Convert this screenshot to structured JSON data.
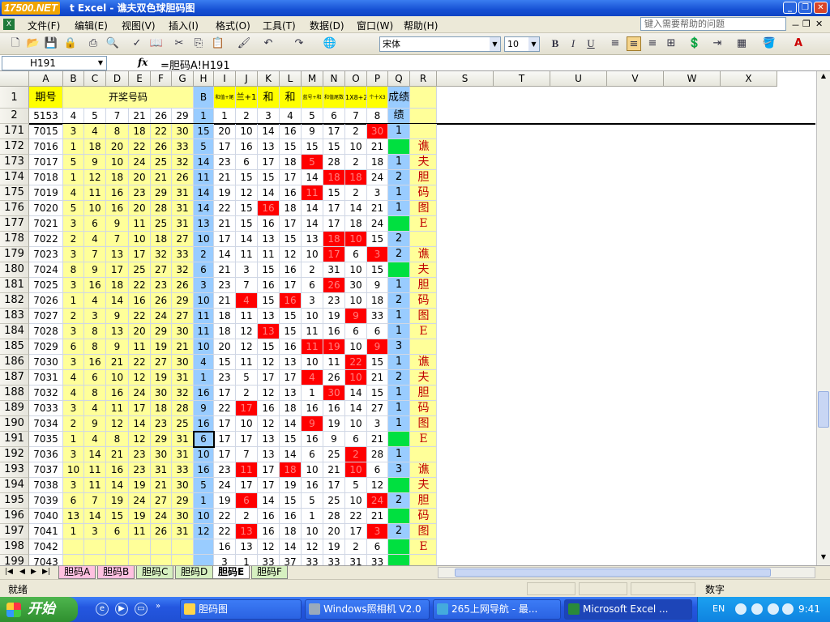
{
  "title": {
    "logo": "17500.NET",
    "text": "t Excel - 谯夫双色球胆码图"
  },
  "menu": [
    "文件(F)",
    "编辑(E)",
    "视图(V)",
    "插入(I)",
    "格式(O)",
    "工具(T)",
    "数据(D)",
    "窗口(W)",
    "帮助(H)"
  ],
  "help_placeholder": "键入需要帮助的问题",
  "font": {
    "name": "宋体",
    "size": "10"
  },
  "namebox": "H191",
  "fx": "fx",
  "formula": "=胆码A!H191",
  "columns": [
    "A",
    "B",
    "C",
    "D",
    "E",
    "F",
    "G",
    "H",
    "I",
    "J",
    "K",
    "L",
    "M",
    "N",
    "O",
    "P",
    "Q",
    "R",
    "S",
    "T",
    "U",
    "V",
    "W",
    "X"
  ],
  "header_row1": {
    "rownum": "1",
    "A": "期号",
    "BG": "开奖号码",
    "H": "B",
    "I": "和值+尾",
    "J": "兰+1",
    "K": "和",
    "L": "和",
    "M": "蓝号+和",
    "N": "和值尾数",
    "O": "1X8+2",
    "P": "个十X3",
    "Q": "成绩"
  },
  "header_row2": {
    "rownum": "2",
    "A": "5153",
    "nums": [
      "4",
      "5",
      "7",
      "21",
      "26",
      "29"
    ],
    "H": "1",
    "idx": [
      "1",
      "2",
      "3",
      "4",
      "5",
      "6",
      "7",
      "8"
    ],
    "Q": "绩"
  },
  "rows": [
    {
      "r": "171",
      "id": "7015",
      "n": [
        "3",
        "4",
        "8",
        "18",
        "22",
        "30"
      ],
      "b": "15",
      "d": [
        "20",
        "10",
        "14",
        "16",
        "9",
        "17",
        "2",
        "30"
      ],
      "red": [
        7
      ],
      "q": "1"
    },
    {
      "r": "172",
      "id": "7016",
      "n": [
        "1",
        "18",
        "20",
        "22",
        "26",
        "33"
      ],
      "b": "5",
      "d": [
        "17",
        "16",
        "13",
        "15",
        "15",
        "15",
        "10",
        "21"
      ],
      "red": [],
      "q": ""
    },
    {
      "r": "173",
      "id": "7017",
      "n": [
        "5",
        "9",
        "10",
        "24",
        "25",
        "32"
      ],
      "b": "14",
      "d": [
        "23",
        "6",
        "17",
        "18",
        "5",
        "28",
        "2",
        "18"
      ],
      "red": [
        4
      ],
      "q": "1"
    },
    {
      "r": "174",
      "id": "7018",
      "n": [
        "1",
        "12",
        "18",
        "20",
        "21",
        "26"
      ],
      "b": "11",
      "d": [
        "21",
        "15",
        "15",
        "17",
        "14",
        "18",
        "18",
        "24"
      ],
      "red": [
        5,
        6
      ],
      "q": "2"
    },
    {
      "r": "175",
      "id": "7019",
      "n": [
        "4",
        "11",
        "16",
        "23",
        "29",
        "31"
      ],
      "b": "14",
      "d": [
        "19",
        "12",
        "14",
        "16",
        "11",
        "15",
        "2",
        "3"
      ],
      "red": [
        4
      ],
      "q": "1"
    },
    {
      "r": "176",
      "id": "7020",
      "n": [
        "5",
        "10",
        "16",
        "20",
        "28",
        "31"
      ],
      "b": "14",
      "d": [
        "22",
        "15",
        "16",
        "18",
        "14",
        "17",
        "14",
        "21"
      ],
      "red": [
        2
      ],
      "q": "1"
    },
    {
      "r": "177",
      "id": "7021",
      "n": [
        "3",
        "6",
        "9",
        "11",
        "25",
        "31"
      ],
      "b": "13",
      "d": [
        "21",
        "15",
        "16",
        "17",
        "14",
        "17",
        "18",
        "24"
      ],
      "red": [],
      "q": ""
    },
    {
      "r": "178",
      "id": "7022",
      "n": [
        "2",
        "4",
        "7",
        "10",
        "18",
        "27"
      ],
      "b": "10",
      "d": [
        "17",
        "14",
        "13",
        "15",
        "13",
        "18",
        "10",
        "15"
      ],
      "red": [
        5,
        6
      ],
      "q": "2"
    },
    {
      "r": "179",
      "id": "7023",
      "n": [
        "3",
        "7",
        "13",
        "17",
        "32",
        "33"
      ],
      "b": "2",
      "d": [
        "14",
        "11",
        "11",
        "12",
        "10",
        "17",
        "6",
        "3"
      ],
      "red": [
        5,
        7
      ],
      "q": "2"
    },
    {
      "r": "180",
      "id": "7024",
      "n": [
        "8",
        "9",
        "17",
        "25",
        "27",
        "32"
      ],
      "b": "6",
      "d": [
        "21",
        "3",
        "15",
        "16",
        "2",
        "31",
        "10",
        "15"
      ],
      "red": [],
      "q": ""
    },
    {
      "r": "181",
      "id": "7025",
      "n": [
        "3",
        "16",
        "18",
        "22",
        "23",
        "26"
      ],
      "b": "3",
      "d": [
        "23",
        "7",
        "16",
        "17",
        "6",
        "26",
        "30",
        "9"
      ],
      "red": [
        5
      ],
      "q": "1"
    },
    {
      "r": "182",
      "id": "7026",
      "n": [
        "1",
        "4",
        "14",
        "16",
        "26",
        "29"
      ],
      "b": "10",
      "d": [
        "21",
        "4",
        "15",
        "16",
        "3",
        "23",
        "10",
        "18"
      ],
      "red": [
        1,
        3
      ],
      "q": "2"
    },
    {
      "r": "183",
      "id": "7027",
      "n": [
        "2",
        "3",
        "9",
        "22",
        "24",
        "27"
      ],
      "b": "11",
      "d": [
        "18",
        "11",
        "13",
        "15",
        "10",
        "19",
        "9",
        "33"
      ],
      "red": [
        6
      ],
      "q": "1"
    },
    {
      "r": "184",
      "id": "7028",
      "n": [
        "3",
        "8",
        "13",
        "20",
        "29",
        "30"
      ],
      "b": "11",
      "d": [
        "18",
        "12",
        "13",
        "15",
        "11",
        "16",
        "6",
        "6"
      ],
      "red": [
        2
      ],
      "q": "1"
    },
    {
      "r": "185",
      "id": "7029",
      "n": [
        "6",
        "8",
        "9",
        "11",
        "19",
        "21"
      ],
      "b": "10",
      "d": [
        "20",
        "12",
        "15",
        "16",
        "11",
        "19",
        "10",
        "9"
      ],
      "red": [
        4,
        5,
        7
      ],
      "q": "3"
    },
    {
      "r": "186",
      "id": "7030",
      "n": [
        "3",
        "16",
        "21",
        "22",
        "27",
        "30"
      ],
      "b": "4",
      "d": [
        "15",
        "11",
        "12",
        "13",
        "10",
        "11",
        "22",
        "15"
      ],
      "red": [
        6
      ],
      "q": "1"
    },
    {
      "r": "187",
      "id": "7031",
      "n": [
        "4",
        "6",
        "10",
        "12",
        "19",
        "31"
      ],
      "b": "1",
      "d": [
        "23",
        "5",
        "17",
        "17",
        "4",
        "26",
        "10",
        "21"
      ],
      "red": [
        4,
        6
      ],
      "q": "2"
    },
    {
      "r": "188",
      "id": "7032",
      "n": [
        "4",
        "8",
        "16",
        "24",
        "30",
        "32"
      ],
      "b": "16",
      "d": [
        "17",
        "2",
        "12",
        "13",
        "1",
        "30",
        "14",
        "15"
      ],
      "red": [
        5
      ],
      "q": "1"
    },
    {
      "r": "189",
      "id": "7033",
      "n": [
        "3",
        "4",
        "11",
        "17",
        "18",
        "28"
      ],
      "b": "9",
      "d": [
        "22",
        "17",
        "16",
        "18",
        "16",
        "16",
        "14",
        "27"
      ],
      "red": [
        1
      ],
      "q": "1"
    },
    {
      "r": "190",
      "id": "7034",
      "n": [
        "2",
        "9",
        "12",
        "14",
        "23",
        "25"
      ],
      "b": "16",
      "d": [
        "17",
        "10",
        "12",
        "14",
        "9",
        "19",
        "10",
        "3"
      ],
      "red": [
        4
      ],
      "q": "1"
    },
    {
      "r": "191",
      "id": "7035",
      "n": [
        "1",
        "4",
        "8",
        "12",
        "29",
        "31"
      ],
      "b": "6",
      "d": [
        "17",
        "17",
        "13",
        "15",
        "16",
        "9",
        "6",
        "21"
      ],
      "red": [],
      "q": ""
    },
    {
      "r": "192",
      "id": "7036",
      "n": [
        "3",
        "14",
        "21",
        "23",
        "30",
        "31"
      ],
      "b": "10",
      "d": [
        "17",
        "7",
        "13",
        "14",
        "6",
        "25",
        "2",
        "28"
      ],
      "red": [
        6
      ],
      "q": "1"
    },
    {
      "r": "193",
      "id": "7037",
      "n": [
        "10",
        "11",
        "16",
        "23",
        "31",
        "33"
      ],
      "b": "16",
      "d": [
        "23",
        "11",
        "17",
        "18",
        "10",
        "21",
        "10",
        "6"
      ],
      "red": [
        1,
        3,
        6
      ],
      "q": "3"
    },
    {
      "r": "194",
      "id": "7038",
      "n": [
        "3",
        "11",
        "14",
        "19",
        "21",
        "30"
      ],
      "b": "5",
      "d": [
        "24",
        "17",
        "17",
        "19",
        "16",
        "17",
        "5",
        "12"
      ],
      "red": [],
      "q": ""
    },
    {
      "r": "195",
      "id": "7039",
      "n": [
        "6",
        "7",
        "19",
        "24",
        "27",
        "29"
      ],
      "b": "1",
      "d": [
        "19",
        "6",
        "14",
        "15",
        "5",
        "25",
        "10",
        "24"
      ],
      "red": [
        1,
        7
      ],
      "q": "2"
    },
    {
      "r": "196",
      "id": "7040",
      "n": [
        "13",
        "14",
        "15",
        "19",
        "24",
        "30"
      ],
      "b": "10",
      "d": [
        "22",
        "2",
        "16",
        "16",
        "1",
        "28",
        "22",
        "21"
      ],
      "red": [],
      "q": ""
    },
    {
      "r": "197",
      "id": "7041",
      "n": [
        "1",
        "3",
        "6",
        "11",
        "26",
        "31"
      ],
      "b": "12",
      "d": [
        "22",
        "13",
        "16",
        "18",
        "10",
        "20",
        "17",
        "3"
      ],
      "red": [
        1,
        7
      ],
      "q": "2"
    },
    {
      "r": "198",
      "id": "7042",
      "n": [
        "",
        "",
        "",
        "",
        "",
        ""
      ],
      "b": "",
      "d": [
        "16",
        "13",
        "12",
        "14",
        "12",
        "19",
        "2",
        "6"
      ],
      "red": [],
      "q": ""
    },
    {
      "r": "199",
      "id": "7043",
      "n": [
        "",
        "",
        "",
        "",
        "",
        ""
      ],
      "b": "",
      "d": [
        "3",
        "1",
        "33",
        "37",
        "33",
        "33",
        "31",
        "33"
      ],
      "red": [],
      "q": ""
    }
  ],
  "side_label": [
    "谯",
    "夫",
    "胆",
    "码",
    "图",
    "E"
  ],
  "sheet_tabs": [
    "胆码A",
    "胆码B",
    "胆码C",
    "胆码D",
    "胆码E",
    "胆码F"
  ],
  "active_tab": "胆码E",
  "status": {
    "left": "就绪",
    "right": "数字"
  },
  "taskbar": {
    "start": "开始",
    "tasks": [
      "胆码图",
      "Windows照相机 V2.0",
      "265上网导航 - 最...",
      "Microsoft Excel ..."
    ],
    "lang": "EN",
    "clock": "9:41"
  },
  "colors": {
    "yellow": "#ffff99",
    "green": "#00e040",
    "red": "#ff0000",
    "blue": "#99ccff",
    "accent_yellow": "#ffff00",
    "label_red": "#c00000"
  }
}
